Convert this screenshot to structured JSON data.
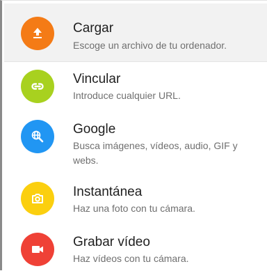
{
  "menu": {
    "items": [
      {
        "title": "Cargar",
        "description": "Escoge un archivo de tu ordenador.",
        "icon": "upload-icon",
        "color": "#f47b16"
      },
      {
        "title": "Vincular",
        "description": "Introduce cualquier URL.",
        "icon": "link-icon",
        "color": "#a8d11f"
      },
      {
        "title": "Google",
        "description": "Busca imágenes, vídeos, audio, GIF y webs.",
        "icon": "web-search-icon",
        "color": "#2196f3"
      },
      {
        "title": "Instantánea",
        "description": "Haz una foto con tu cámara.",
        "icon": "camera-icon",
        "color": "#fbcf0f"
      },
      {
        "title": "Grabar vídeo",
        "description": "Haz vídeos con tu cámara.",
        "icon": "video-camera-icon",
        "color": "#ef4136"
      }
    ]
  }
}
